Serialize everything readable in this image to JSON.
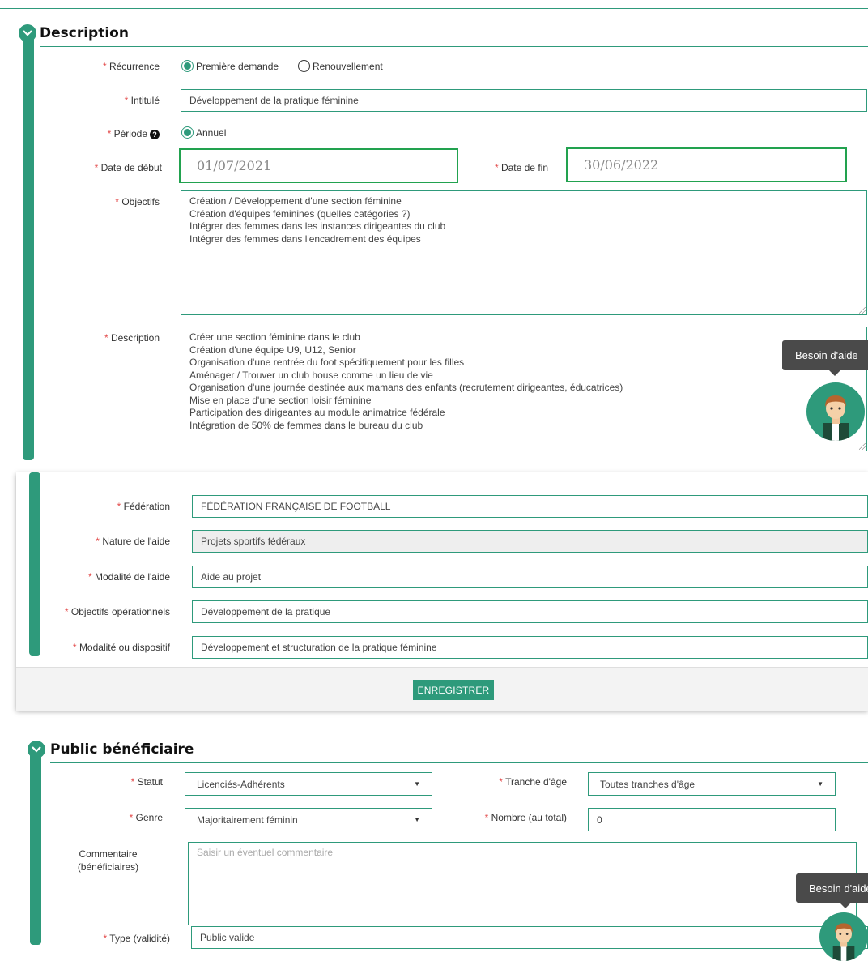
{
  "description": {
    "title": "Description",
    "recurrence": {
      "label": "Récurrence",
      "option1": "Première demande",
      "option2": "Renouvellement"
    },
    "intitule": {
      "label": "Intitulé",
      "value": "Développement de la pratique féminine"
    },
    "periode": {
      "label": "Période",
      "option": "Annuel"
    },
    "date_debut": {
      "label": "Date de début",
      "value": "01/07/2021"
    },
    "date_fin": {
      "label": "Date de fin",
      "value": "30/06/2022"
    },
    "objectifs": {
      "label": "Objectifs",
      "lines": [
        "Création / Développement d'une section féminine",
        "Création d'équipes féminines (quelles catégories ?)",
        "Intégrer des femmes dans les instances dirigeantes du club",
        "Intégrer des femmes dans l'encadrement des équipes"
      ]
    },
    "description_field": {
      "label": "Description",
      "lines": [
        "Créer une section féminine dans le club",
        "Création d'une équipe U9, U12, Senior",
        "Organisation d'une rentrée du foot spécifiquement pour les filles",
        "Aménager / Trouver un club house comme un lieu de vie",
        "Organisation d'une journée destinée aux mamans des enfants (recrutement dirigeantes, éducatrices)",
        "Mise en place d'une section loisir féminine",
        "Participation des dirigeantes au module animatrice fédérale",
        "Intégration de 50% de femmes dans le bureau du club"
      ]
    }
  },
  "help": {
    "tooltip1": "Besoin d'aide",
    "tooltip2": "Besoin d'aide"
  },
  "federation_panel": {
    "federation": {
      "label": "Fédération",
      "value": "FÉDÉRATION FRANÇAISE DE FOOTBALL"
    },
    "nature": {
      "label": "Nature de l'aide",
      "value": "Projets sportifs fédéraux"
    },
    "modalite_aide": {
      "label": "Modalité de l'aide",
      "value": "Aide au projet"
    },
    "objectifs_op": {
      "label": "Objectifs opérationnels",
      "value": "Développement de la pratique"
    },
    "modalite_dispositif": {
      "label": "Modalité ou dispositif",
      "value": "Développement et structuration de la pratique féminine"
    },
    "save_label": "ENREGISTRER"
  },
  "public": {
    "title": "Public bénéficiaire",
    "statut": {
      "label": "Statut",
      "value": "Licenciés-Adhérents"
    },
    "tranche": {
      "label": "Tranche d'âge",
      "value": "Toutes tranches d'âge"
    },
    "genre": {
      "label": "Genre",
      "value": "Majoritairement féminin"
    },
    "nombre": {
      "label": "Nombre (au total)",
      "value": "0"
    },
    "commentaire": {
      "label1": "Commentaire",
      "label2": "(bénéficiaires)",
      "placeholder": "Saisir un éventuel commentaire"
    },
    "type": {
      "label": "Type (validité)",
      "value": "Public valide"
    }
  },
  "colors": {
    "accent": "#2e9a7b",
    "required": "#e34b4b",
    "date_border": "#22a24f",
    "tooltip": "#4a4a4a"
  },
  "required_mark": "*"
}
